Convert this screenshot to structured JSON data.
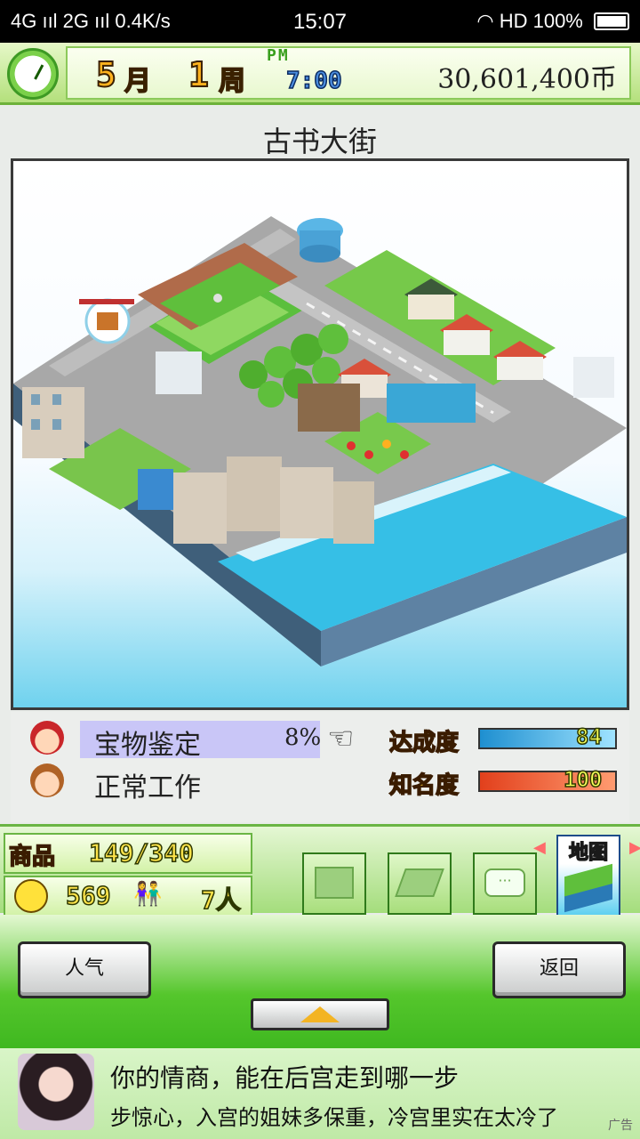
{
  "status_bar": {
    "network": "4G ııl 2G ııl",
    "speed": "0.4K/s",
    "time": "15:07",
    "right_icons": "HD",
    "battery": "100%"
  },
  "top_bar": {
    "month_num": "5",
    "month_unit": "月",
    "week_num": "1",
    "week_unit": "周",
    "ampm": "PM",
    "clock_time": "7:00",
    "money": "30,601,400币"
  },
  "location": "古书大街",
  "activity": {
    "task_name": "宝物鉴定",
    "task_progress": "8%",
    "work_status": "正常工作"
  },
  "meters": {
    "achievement_label": "达成度",
    "achievement_value": "84",
    "achievement_fraction": 0.84,
    "fame_label": "知名度",
    "fame_value": "100",
    "fame_fraction": 1.0
  },
  "panel": {
    "goods_label": "商品",
    "goods_value": "149/340",
    "mood_value": "569",
    "staff_value": "7人",
    "buttons": [
      "shop-icon",
      "cash-icon",
      "chat-icon"
    ],
    "map_label": "地图"
  },
  "nav": {
    "left_label": "人气",
    "right_label": "返回"
  },
  "ad": {
    "title": "你的情商，能在后宫走到哪一步",
    "description": "步惊心，入宫的姐妹多保重，冷宫里实在太冷了",
    "tag": "广告"
  },
  "colors": {
    "achievement_bar": "#3fb7f0",
    "fame_bar": "#f0562a",
    "accent_green": "#6ab544"
  }
}
